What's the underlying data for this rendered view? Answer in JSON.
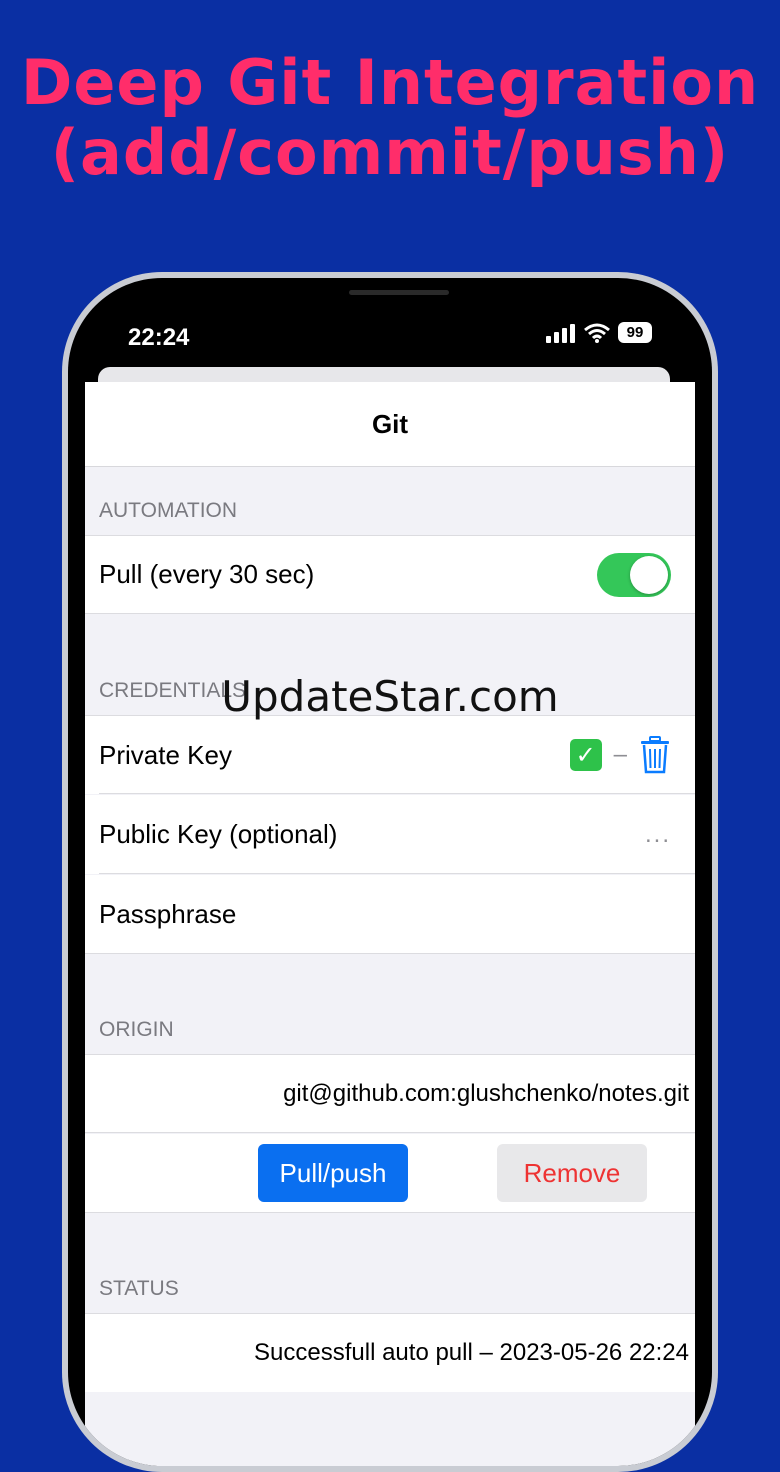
{
  "headline": {
    "line1": "Deep Git Integration",
    "line2": "(add/commit/push)"
  },
  "status_bar": {
    "time": "22:24",
    "battery": "99",
    "icons": [
      "cellular-signal-icon",
      "wifi-icon",
      "battery-icon"
    ]
  },
  "sheet": {
    "title": "Git"
  },
  "automation": {
    "header": "AUTOMATION",
    "pull_label": "Pull (every 30 sec)",
    "pull_enabled": true
  },
  "credentials": {
    "header": "CREDENTIALS",
    "private_key_label": "Private Key",
    "private_key_check": "✓",
    "private_key_dash": "–",
    "public_key_label": "Public Key (optional)",
    "public_key_action": "...",
    "passphrase_label": "Passphrase"
  },
  "origin": {
    "header": "ORIGIN",
    "url": "git@github.com:glushchenko/notes.git",
    "pull_push_label": "Pull/push",
    "remove_label": "Remove"
  },
  "status": {
    "header": "STATUS",
    "message": "Successfull auto pull – 2023-05-26 22:24"
  },
  "watermark": "UpdateStar.com",
  "colors": {
    "background": "#0a2fa3",
    "headline": "#ff2d6a",
    "toggle_on": "#34c759",
    "primary_button": "#0a6ff0",
    "destructive_text": "#ee3333",
    "trash_icon": "#0a7cff"
  }
}
